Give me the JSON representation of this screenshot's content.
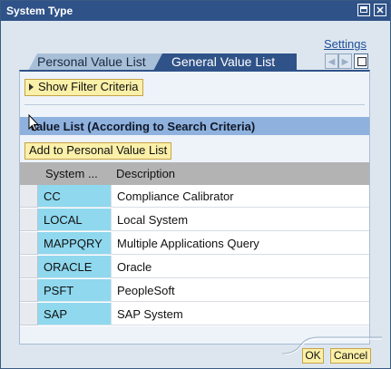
{
  "window": {
    "title": "System Type",
    "maximize_icon": "maximize-icon",
    "close_icon": "close-icon",
    "close_glyph": "✕"
  },
  "settings_link": "Settings",
  "tabs": [
    {
      "label": "Personal Value List",
      "active": false
    },
    {
      "label": "General Value List",
      "active": true
    }
  ],
  "tab_nav": {
    "prev": "◀",
    "next": "▶"
  },
  "filter_button": "Show Filter Criteria",
  "list_title": "Value List (According to Search Criteria)",
  "add_button": "Add to Personal Value List",
  "table": {
    "columns": [
      "System ...",
      "Description"
    ],
    "rows": [
      {
        "system": "CC",
        "description": "Compliance Calibrator"
      },
      {
        "system": "LOCAL",
        "description": "Local System"
      },
      {
        "system": "MAPPQRY",
        "description": "Multiple Applications Query"
      },
      {
        "system": "ORACLE",
        "description": "Oracle"
      },
      {
        "system": "PSFT",
        "description": "PeopleSoft"
      },
      {
        "system": "SAP",
        "description": "SAP System"
      }
    ]
  },
  "footer": {
    "ok": "OK",
    "cancel": "Cancel"
  },
  "colors": {
    "titlebar": "#2f5288",
    "active_tab": "#2f5288",
    "button_bg": "#fbf0a8",
    "key_column": "#8fd8ee",
    "list_header": "#8fb1dd"
  }
}
